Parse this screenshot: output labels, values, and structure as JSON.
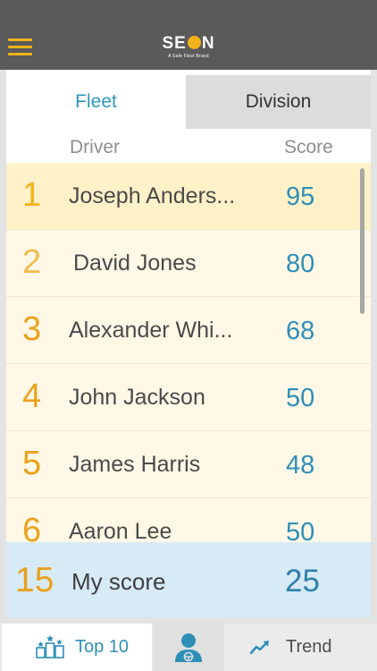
{
  "header": {
    "logo_text_pre": "SE",
    "logo_text_post": "N",
    "logo_tagline": "A Safe Fleet Brand",
    "brand_color": "#f2b21a",
    "menu_icon": "hamburger-menu-icon"
  },
  "tabs": [
    {
      "label": "Fleet",
      "active": true
    },
    {
      "label": "Division",
      "active": false
    }
  ],
  "columns": {
    "driver": "Driver",
    "score": "Score"
  },
  "drivers": [
    {
      "rank": "1",
      "name": "Joseph Anders...",
      "score": "95"
    },
    {
      "rank": "2",
      "name": "David Jones",
      "score": "80"
    },
    {
      "rank": "3",
      "name": "Alexander Whi...",
      "score": "68"
    },
    {
      "rank": "4",
      "name": "John Jackson",
      "score": "50"
    },
    {
      "rank": "5",
      "name": "James Harris",
      "score": "48"
    },
    {
      "rank": "6",
      "name": "Aaron Lee",
      "score": "50"
    }
  ],
  "my_score": {
    "rank": "15",
    "label": "My score",
    "score": "25"
  },
  "nav": {
    "top10": {
      "label": "Top 10",
      "icon": "podium-icon"
    },
    "profile": {
      "icon": "driver-profile-icon"
    },
    "trend": {
      "label": "Trend",
      "icon": "trend-chart-icon"
    }
  },
  "colors": {
    "accent_blue": "#2e8fb8",
    "rank_orange": "#e9a21c",
    "header_bg": "#5a5a5a",
    "my_score_bg": "#d7ebf7"
  }
}
